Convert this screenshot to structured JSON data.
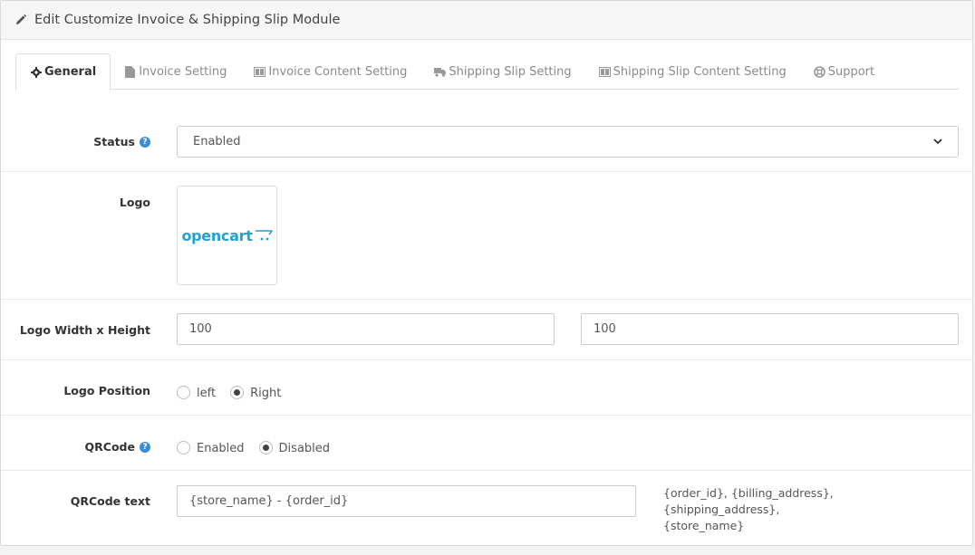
{
  "header": {
    "title": "Edit Customize Invoice & Shipping Slip Module",
    "icon": "pencil-icon"
  },
  "tabs": [
    {
      "label": "General",
      "icon": "gear-icon",
      "active": true
    },
    {
      "label": "Invoice Setting",
      "icon": "file-icon",
      "active": false
    },
    {
      "label": "Invoice Content Setting",
      "icon": "columns-icon",
      "active": false
    },
    {
      "label": "Shipping Slip Setting",
      "icon": "truck-icon",
      "active": false
    },
    {
      "label": "Shipping Slip Content Setting",
      "icon": "columns-icon",
      "active": false
    },
    {
      "label": "Support",
      "icon": "lifebuoy-icon",
      "active": false
    }
  ],
  "form": {
    "status": {
      "label": "Status",
      "value": "Enabled"
    },
    "logo": {
      "label": "Logo",
      "image_text": "opencart"
    },
    "logo_size": {
      "label": "Logo Width x Height",
      "width": "100",
      "height": "100"
    },
    "logo_position": {
      "label": "Logo Position",
      "options": [
        "left",
        "Right"
      ],
      "selected": "Right"
    },
    "qrcode": {
      "label": "QRCode",
      "options": [
        "Enabled",
        "Disabled"
      ],
      "selected": "Disabled"
    },
    "qrcode_text": {
      "label": "QRCode text",
      "value": "{store_name} - {order_id}",
      "hint_line1": "{order_id}, {billing_address}, {shipping_address},",
      "hint_line2": "{store_name}"
    }
  },
  "colors": {
    "accent": "#3a8dd4",
    "opencart_blue": "#23a1d1"
  }
}
